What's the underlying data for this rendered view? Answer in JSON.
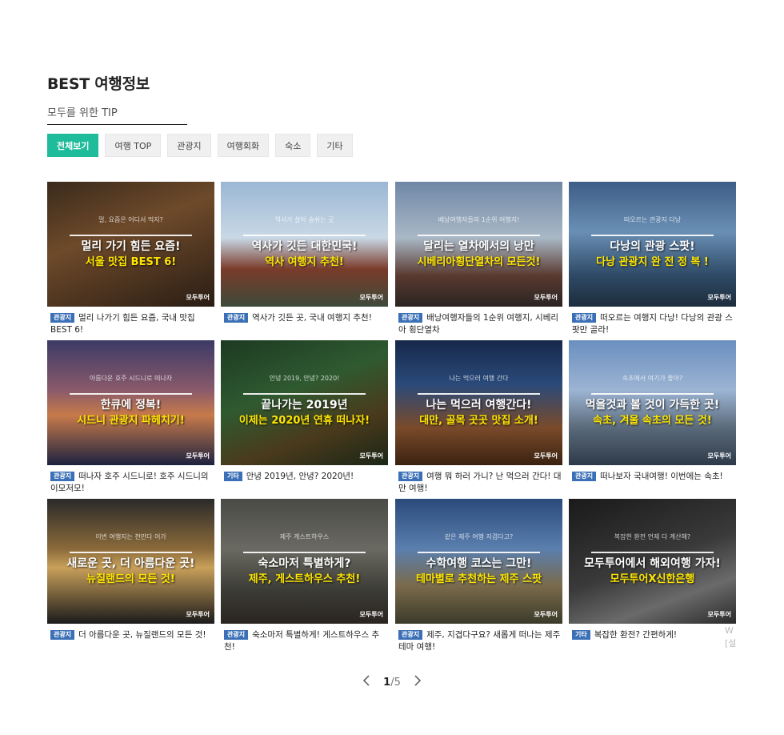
{
  "section": {
    "title": "BEST 여행정보",
    "subtitle": "모두를 위한 TIP"
  },
  "filters": [
    "전체보기",
    "여행 TOP",
    "관광지",
    "여행회화",
    "숙소",
    "기타"
  ],
  "watermark": "모두투어",
  "cards": [
    {
      "tag": "관광지",
      "caption": "멀리 나가기 힘든 요즘, 국내 맛집 BEST 6!",
      "small": "멀, 요즘은 어디서 먹지?",
      "line1": "멀리 가기 힘든 요즘!",
      "line2": "서울 맛집 BEST 6!",
      "bg": "linear-gradient(160deg,#3a2a1c 0%,#6e4a2a 40%,#2a1d14 100%)"
    },
    {
      "tag": "관광지",
      "caption": "역사가 깃든 곳, 국내 여행지 추천!",
      "small": "역사가 살아 숨쉬는 곳",
      "line1": "역사가 깃든 대한민국!",
      "line2": "역사 여행지 추천!",
      "bg": "linear-gradient(180deg,#9bb7d4 0%,#c9d8e6 45%,#7a3b2a 70%,#3d4a3a 100%)"
    },
    {
      "tag": "관광지",
      "caption": "배낭여행자들의 1순위 여행지, 시베리아 횡단열차",
      "small": "배낭여행자들의 1순위 여행지!",
      "line1": "달리는 열차에서의 낭만",
      "line2": "시베리아횡단열차의 모든것!",
      "bg": "linear-gradient(180deg,#6f87a6 0%,#a9b8c6 45%,#5a3a30 75%,#2b2422 100%)"
    },
    {
      "tag": "관광지",
      "caption": "떠오르는 여행지 다낭! 다낭의 관광 스팟만 골라!",
      "small": "떠오르는 관광지 다낭",
      "line1": "다낭의 관광 스팟!",
      "line2": "다낭 관광지 완 전 정 복 !",
      "bg": "linear-gradient(180deg,#3d5d86 0%,#6a8fb5 40%,#2e4a66 75%,#1d2d3c 100%)"
    },
    {
      "tag": "관광지",
      "caption": "떠나자 호주 시드니로! 호주 시드니의 이모저모!",
      "small": "아름다운 호주 시드니로 떠나자",
      "line1": "한큐에 정복!",
      "line2": "시드니 관광지 파헤치기!",
      "bg": "linear-gradient(180deg,#3b3a66 0%,#8a5a6a 40%,#c77a4a 60%,#1d2240 100%)"
    },
    {
      "tag": "기타",
      "caption": "안녕 2019년, 안녕? 2020년!",
      "small": "안녕 2019, 안녕? 2020!",
      "line1": "끝나가는 2019년",
      "line2": "이제는 2020년 연휴 떠나자!",
      "bg": "linear-gradient(160deg,#1d3a22 0%,#2f5a30 40%,#4a3a1c 70%,#1a2616 100%)"
    },
    {
      "tag": "관광지",
      "caption": "여행 뭐 하러 가니? 난 먹으러 간다! 대만 여행!",
      "small": "나는 먹으러 여행 간다",
      "line1": "나는 먹으러 여행간다!",
      "line2": "대만, 골목 곳곳 맛집 소개!",
      "bg": "linear-gradient(180deg,#16284a 0%,#2a4a7a 35%,#7a4a2a 70%,#3a2210 100%)"
    },
    {
      "tag": "관광지",
      "caption": "떠나보자 국내여행! 이번에는 속초!",
      "small": "속초에서 여기가 좋아?",
      "line1": "먹을것과 볼 것이 가득한 곳!",
      "line2": "속초, 겨울 속초의 모든 것!",
      "bg": "linear-gradient(180deg,#6a8fc0 0%,#9cb4d3 40%,#5a6a7a 70%,#2e3a4a 100%)"
    },
    {
      "tag": "관광지",
      "caption": "더 아름다운 곳, 뉴질랜드의 모든 것!",
      "small": "이번 여행지는 천만다 어가",
      "line1": "새로운 곳, 더 아름다운 곳!",
      "line2": "뉴질랜드의 모든 것!",
      "bg": "linear-gradient(180deg,#2a2a2a 0%,#8a6a3a 40%,#c9a05a 55%,#1a1a1a 100%)"
    },
    {
      "tag": "관광지",
      "caption": "숙소마저 특별하게! 게스트하우스 추천!",
      "small": "제주 게스트하우스",
      "line1": "숙소마저 특별하게?",
      "line2": "제주, 게스트하우스 추천!",
      "bg": "linear-gradient(180deg,#4a4a46 0%,#6a6a62 40%,#3a3a34 75%,#2a2420 100%)"
    },
    {
      "tag": "관광지",
      "caption": "제주, 지겹다구요? 새롭게 떠나는 제주 테마 여행!",
      "small": "같은 제주 여행 지겹다고?",
      "line1": "수학여행 코스는 그만!",
      "line2": "테마별로 추천하는 제주 스팟",
      "bg": "linear-gradient(180deg,#2a4a7a 0%,#5a7fae 40%,#7a6a4a 70%,#3a3a2a 100%)"
    },
    {
      "tag": "기타",
      "caption": "복잡한 환전? 간편하게!",
      "small": "복잡한 환전 언제 다 계산해?",
      "line1": "모두투어에서 해외여행 가자!",
      "line2": "모두투어X신한은행",
      "bg": "linear-gradient(160deg,#1a1a1a 0%,#3a3a3a 50%,#6a6a6a 75%,#2a2a2a 100%)"
    }
  ],
  "edge_text": [
    "W",
    "[설"
  ],
  "pagination": {
    "current": "1",
    "total": "/5",
    "prev_icon": "chevron-left-icon",
    "next_icon": "chevron-right-icon"
  }
}
